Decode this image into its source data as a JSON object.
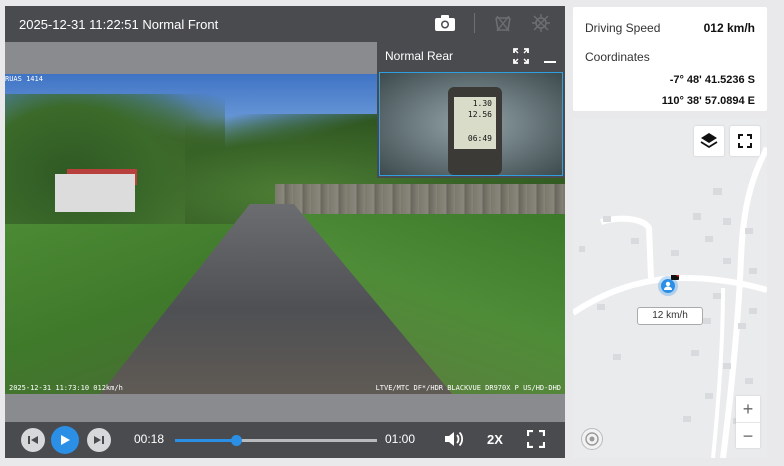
{
  "player": {
    "title": "2025-12-31 11:22:51 Normal Front",
    "osd_top_left": "RUAS 1414",
    "osd_bottom_left": "2025-12-31 11:73:10 012km/h",
    "osd_bottom_right": "LTVE/MTC DF*/HDR BLACKVUE DR970X P US/HD-DHD"
  },
  "rear": {
    "title": "Normal Rear",
    "gps_lines": [
      "1.30",
      "12.56",
      "",
      "06:49"
    ]
  },
  "controls": {
    "current_time": "00:18",
    "duration": "01:00",
    "progress": 0.3,
    "speed": "2X"
  },
  "info": {
    "speed_label": "Driving Speed",
    "speed_value": "012 km/h",
    "coords_label": "Coordinates",
    "lat": "-7° 48' 41.5236 S",
    "lon": "110° 38' 57.0894 E"
  },
  "map": {
    "speed_tag": "12 km/h",
    "zoom_in": "+",
    "zoom_out": "−"
  },
  "icons": [
    "camera-icon",
    "download-disabled-icon",
    "gps-off-icon",
    "expand-icon",
    "minimize-icon",
    "prev-frame-icon",
    "play-icon",
    "next-frame-icon",
    "volume-icon",
    "fullscreen-icon",
    "layers-icon",
    "map-fullscreen-icon",
    "vehicle-marker-icon",
    "map-logo-icon"
  ],
  "colors": {
    "accent": "#2b8fe6",
    "bar": "#4a4b4f"
  }
}
